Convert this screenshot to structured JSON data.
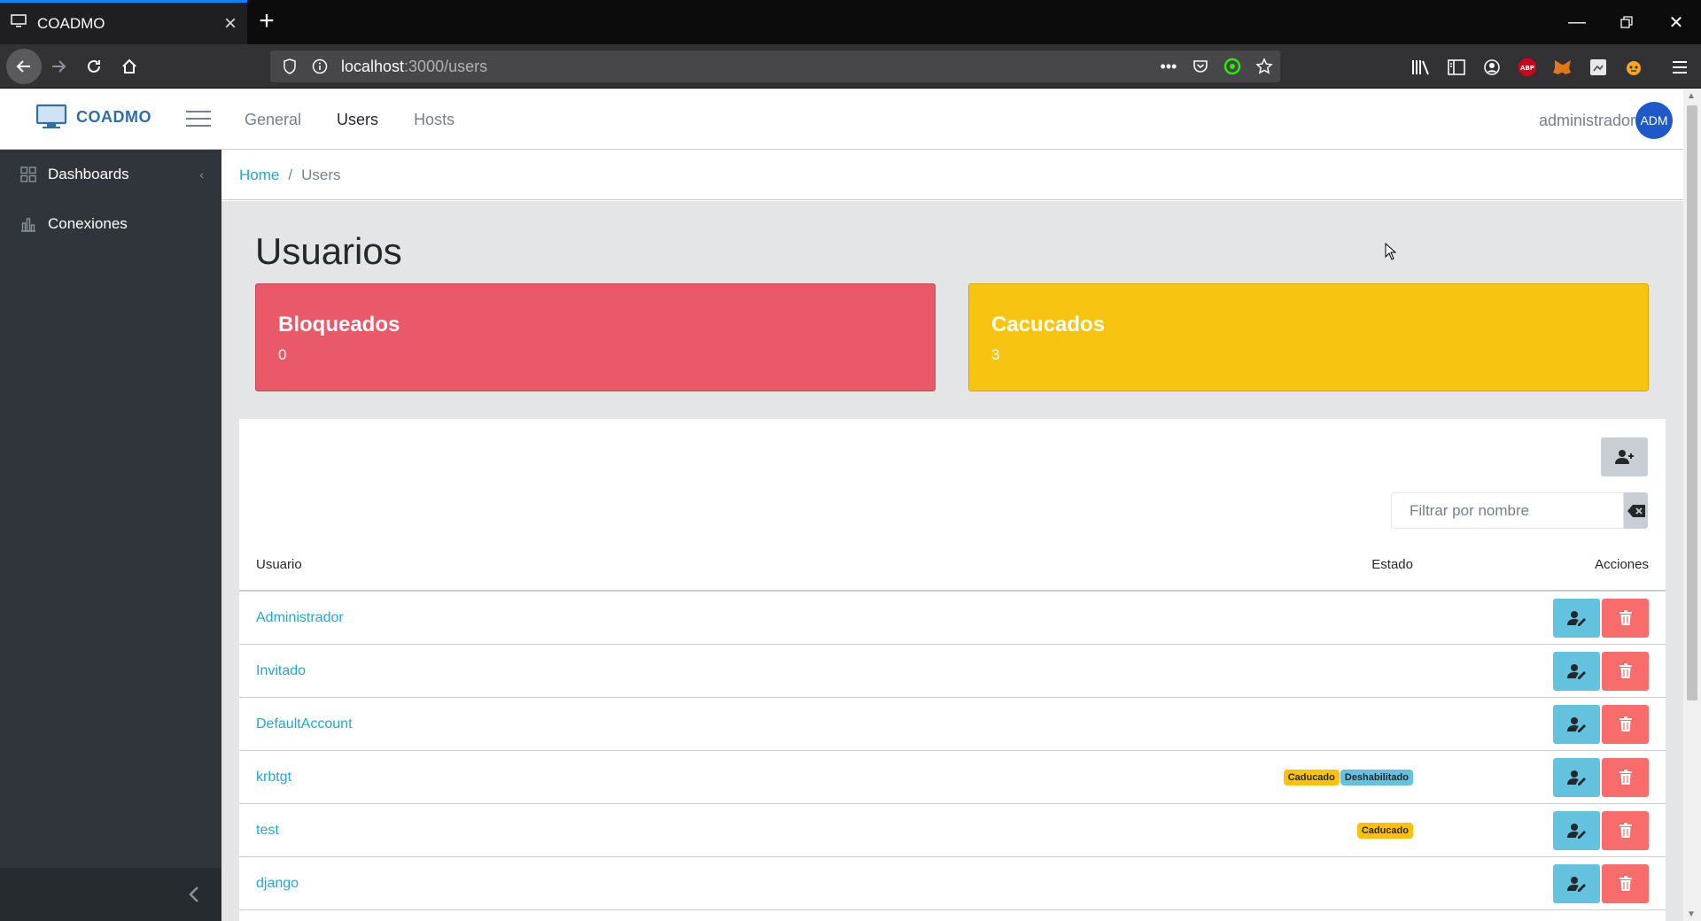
{
  "browser": {
    "tab_title": "COADMO",
    "url_host": "localhost",
    "url_path": ":3000/users"
  },
  "app": {
    "brand": "COADMO",
    "nav": [
      {
        "label": "General"
      },
      {
        "label": "Users"
      },
      {
        "label": "Hosts"
      }
    ],
    "user_name": "administrador",
    "avatar_initials": "ADM"
  },
  "sidebar": {
    "items": [
      {
        "label": "Dashboards",
        "icon": "grid-icon"
      },
      {
        "label": "Conexiones",
        "icon": "bar-chart-icon"
      }
    ]
  },
  "breadcrumb": {
    "home": "Home",
    "separator": "/",
    "current": "Users"
  },
  "page": {
    "title": "Usuarios",
    "cards": [
      {
        "title": "Bloqueados",
        "value": "0",
        "color": "#e9596a"
      },
      {
        "title": "Cacucados",
        "value": "3",
        "color": "#f7c412"
      }
    ],
    "filter_placeholder": "Filtrar por nombre",
    "table": {
      "headers": {
        "user": "Usuario",
        "status": "Estado",
        "actions": "Acciones"
      },
      "rows": [
        {
          "name": "Administrador",
          "badges": []
        },
        {
          "name": "Invitado",
          "badges": []
        },
        {
          "name": "DefaultAccount",
          "badges": []
        },
        {
          "name": "krbtgt",
          "badges": [
            "Caducado",
            "Deshabilitado"
          ]
        },
        {
          "name": "test",
          "badges": [
            "Caducado"
          ]
        },
        {
          "name": "django",
          "badges": []
        }
      ]
    }
  }
}
